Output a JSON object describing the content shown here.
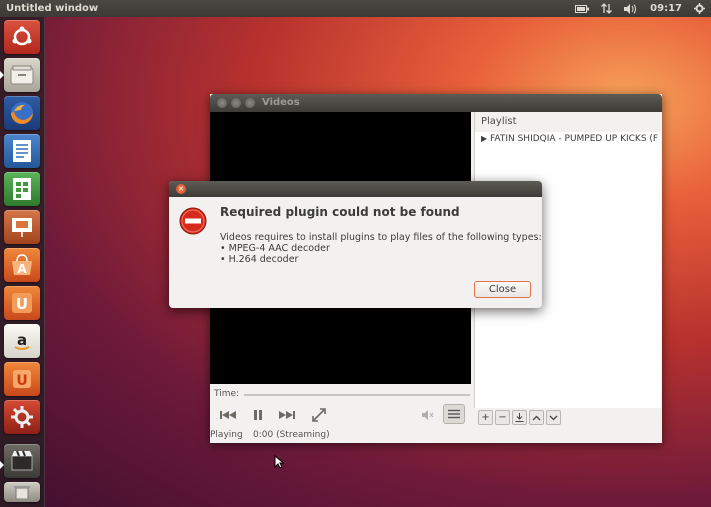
{
  "top_panel": {
    "window_title": "Untitled window",
    "clock": "09:17",
    "icons": [
      "battery-icon",
      "network-icon",
      "volume-icon",
      "settings-gear-icon"
    ]
  },
  "launcher": {
    "items": [
      {
        "name": "ubuntu-dash-icon",
        "color": "#c73a2b"
      },
      {
        "name": "files-icon",
        "color": "#c7c2b6"
      },
      {
        "name": "firefox-icon",
        "color": "#e56a1c"
      },
      {
        "name": "libreoffice-writer-icon",
        "color": "#2e6fb5"
      },
      {
        "name": "libreoffice-calc-icon",
        "color": "#3e9a3c"
      },
      {
        "name": "libreoffice-impress-icon",
        "color": "#b6542a"
      },
      {
        "name": "software-center-icon",
        "color": "#e2622a"
      },
      {
        "name": "ubuntu-one-icon",
        "color": "#e2622a"
      },
      {
        "name": "amazon-icon",
        "color": "#f0efe9"
      },
      {
        "name": "ubuntu-one-music-icon",
        "color": "#e2622a"
      },
      {
        "name": "system-settings-icon",
        "color": "#b8322a"
      },
      {
        "name": "videos-icon",
        "color": "#4c4a45"
      }
    ]
  },
  "videos_window": {
    "title": "Videos",
    "playlist_header": "Playlist",
    "playlist_items": [
      "FATIN SHIDQIA - PUMPED UP KICKS (F"
    ],
    "time_label": "Time:",
    "status": "Playing",
    "status_time": "0:00 (Streaming)"
  },
  "dialog": {
    "heading": "Required plugin could not be found",
    "message": "Videos requires to install plugins to play files of the following types:",
    "items": [
      "• MPEG-4 AAC decoder",
      "• H.264 decoder"
    ],
    "close_label": "Close"
  },
  "colors": {
    "accent": "#e1714a",
    "panel": "#3b3a36"
  }
}
